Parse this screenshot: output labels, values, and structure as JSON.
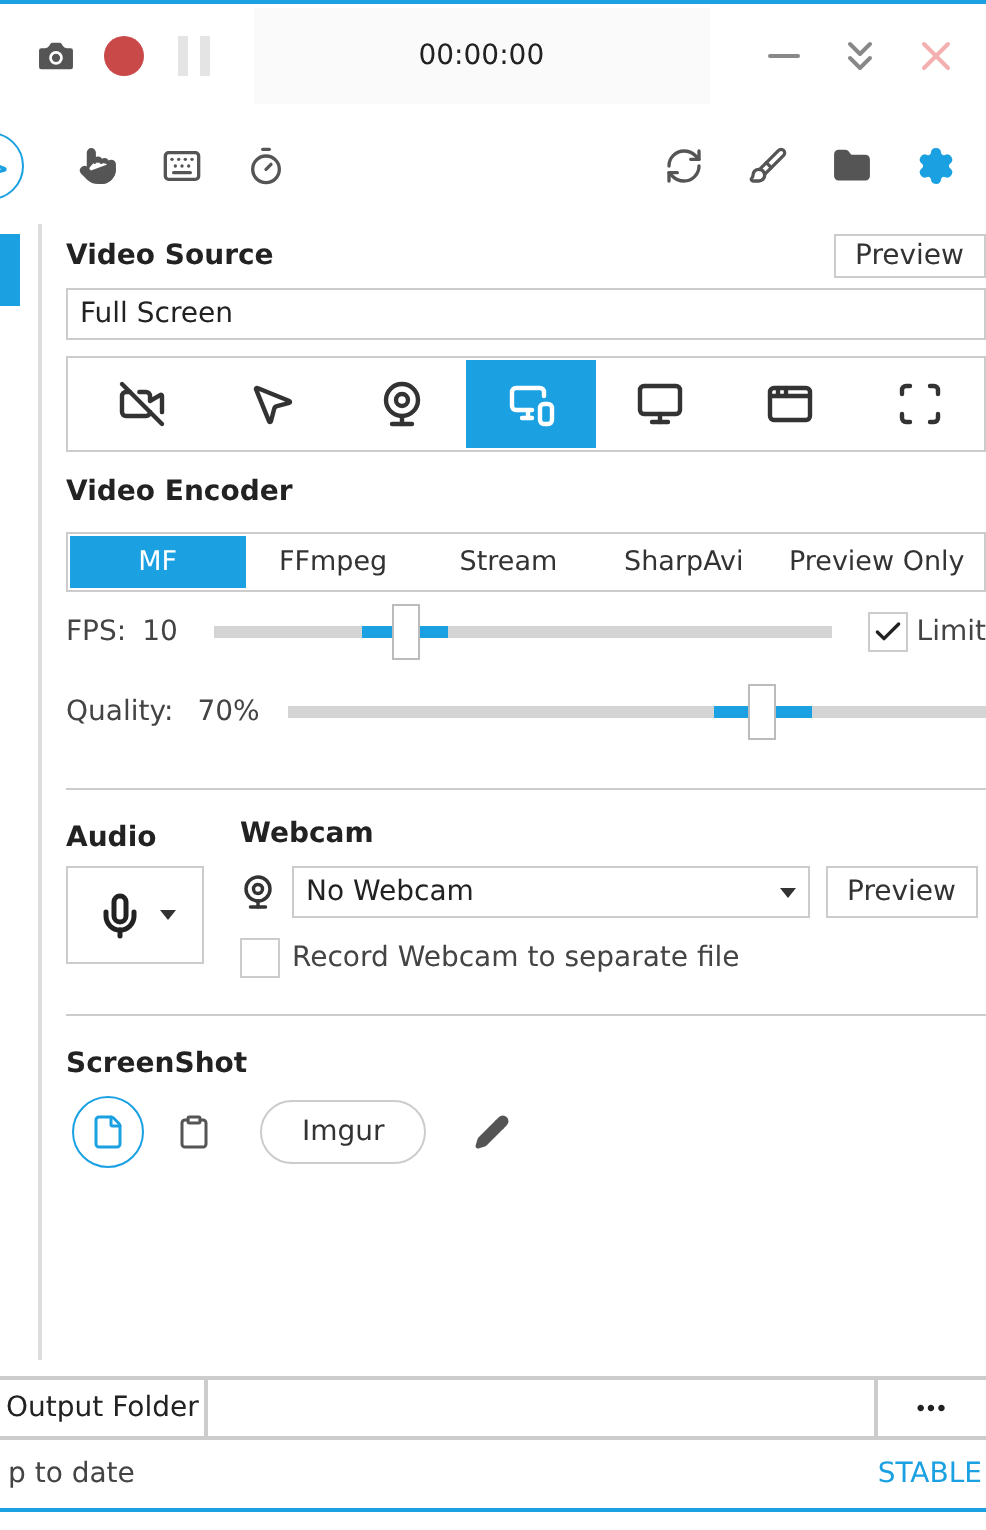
{
  "title_bar": {
    "timer": "00:00:00",
    "record_disabled": false,
    "pause_disabled": true
  },
  "toolbar": {
    "left": [
      {
        "kind": "cursor",
        "selected": true
      },
      {
        "kind": "hand",
        "selected": false
      },
      {
        "kind": "keyboard",
        "selected": false
      },
      {
        "kind": "timer",
        "selected": false
      }
    ],
    "right": [
      {
        "kind": "sync",
        "selected": false
      },
      {
        "kind": "brush",
        "selected": false
      },
      {
        "kind": "folder",
        "selected": false
      },
      {
        "kind": "settings",
        "selected": true
      }
    ]
  },
  "video_source": {
    "title": "Video Source",
    "preview_button": "Preview",
    "value": "Full Screen",
    "modes": [
      {
        "kind": "none",
        "selected": false
      },
      {
        "kind": "region",
        "selected": false
      },
      {
        "kind": "webcam",
        "selected": false
      },
      {
        "kind": "fullscreen",
        "selected": true
      },
      {
        "kind": "screen",
        "selected": false
      },
      {
        "kind": "window",
        "selected": false
      },
      {
        "kind": "area",
        "selected": false
      }
    ]
  },
  "video_encoder": {
    "title": "Video Encoder",
    "tabs": [
      {
        "label": "MF",
        "selected": true
      },
      {
        "label": "FFmpeg",
        "selected": false
      },
      {
        "label": "Stream",
        "selected": false
      },
      {
        "label": "SharpAvi",
        "selected": false
      },
      {
        "label": "Preview Only",
        "selected": false
      }
    ],
    "fps": {
      "label": "FPS:",
      "reading": "10",
      "level": 0.31,
      "limit_label": "Limit",
      "limit_checked": true
    },
    "quality": {
      "label": "Quality:",
      "reading": "70%",
      "level": 0.68
    }
  },
  "audio": {
    "title": "Audio"
  },
  "webcam": {
    "title": "Webcam",
    "value": "No Webcam",
    "preview_button": "Preview",
    "separate_file_label": "Record Webcam to separate file",
    "separate_file_checked": false
  },
  "screenshot": {
    "title": "ScreenShot",
    "targets": [
      {
        "kind": "file",
        "selected": true
      },
      {
        "kind": "clipboard",
        "selected": false
      },
      {
        "kind": "imgur",
        "label": "Imgur",
        "selected": false
      },
      {
        "kind": "editor",
        "selected": false
      }
    ]
  },
  "output": {
    "label": "Output Folder",
    "more": "•••"
  },
  "status_bar": {
    "status": "p to date",
    "channel": "STABLE"
  }
}
